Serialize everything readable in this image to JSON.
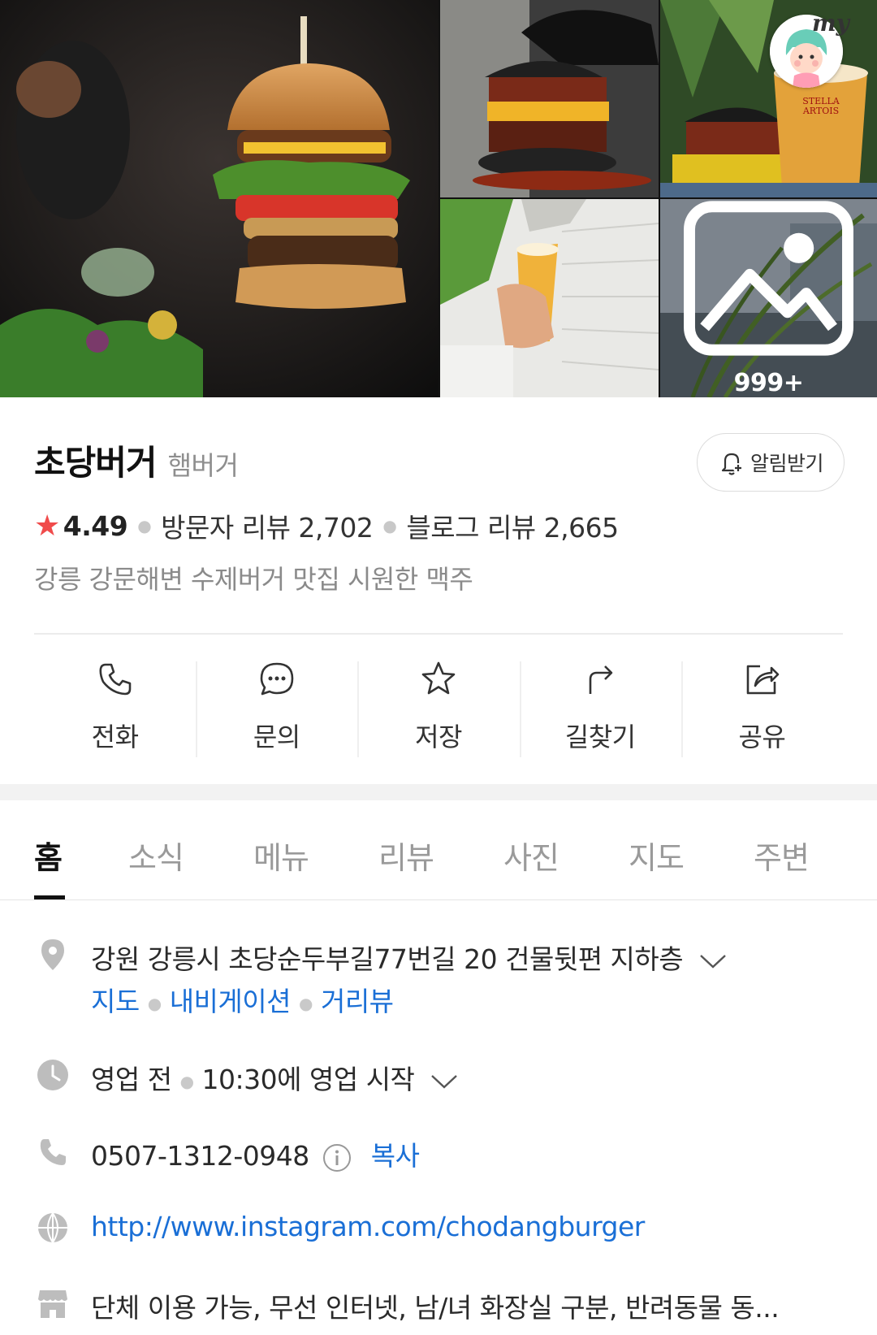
{
  "gallery": {
    "more_count": "999+",
    "badge_label": "my",
    "photos": [
      "burger-photo",
      "black-bun-burger-photo",
      "burger-with-beer-photo",
      "beer-tap-photo",
      "storefront-photo"
    ]
  },
  "place": {
    "name": "초당버거",
    "category": "햄버거",
    "alert_label": "알림받기",
    "rating": "4.49",
    "visitor_reviews": "방문자 리뷰 2,702",
    "blog_reviews": "블로그 리뷰 2,665",
    "description": "강릉 강문해변 수제버거 맛집 시원한 맥주"
  },
  "actions": [
    {
      "label": "전화",
      "icon": "phone-icon"
    },
    {
      "label": "문의",
      "icon": "chat-icon"
    },
    {
      "label": "저장",
      "icon": "star-icon"
    },
    {
      "label": "길찾기",
      "icon": "directions-icon"
    },
    {
      "label": "공유",
      "icon": "share-icon"
    }
  ],
  "tabs": [
    {
      "label": "홈",
      "active": true
    },
    {
      "label": "소식"
    },
    {
      "label": "메뉴"
    },
    {
      "label": "리뷰"
    },
    {
      "label": "사진"
    },
    {
      "label": "지도"
    },
    {
      "label": "주변"
    }
  ],
  "info": {
    "address": "강원 강릉시 초당순두부길77번길 20 건물뒷편 지하층",
    "address_links": [
      "지도",
      "내비게이션",
      "거리뷰"
    ],
    "hours_status": "영업 전",
    "hours_detail": "10:30에 영업 시작",
    "phone": "0507-1312-0948",
    "copy_label": "복사",
    "website": "http://www.instagram.com/chodangburger",
    "amenities": "단체 이용 가능, 무선 인터넷, 남/녀 화장실 구분, 반려동물 동..."
  },
  "colors": {
    "accent_blue": "#1a6fd6",
    "star_red": "#f04b4b"
  }
}
